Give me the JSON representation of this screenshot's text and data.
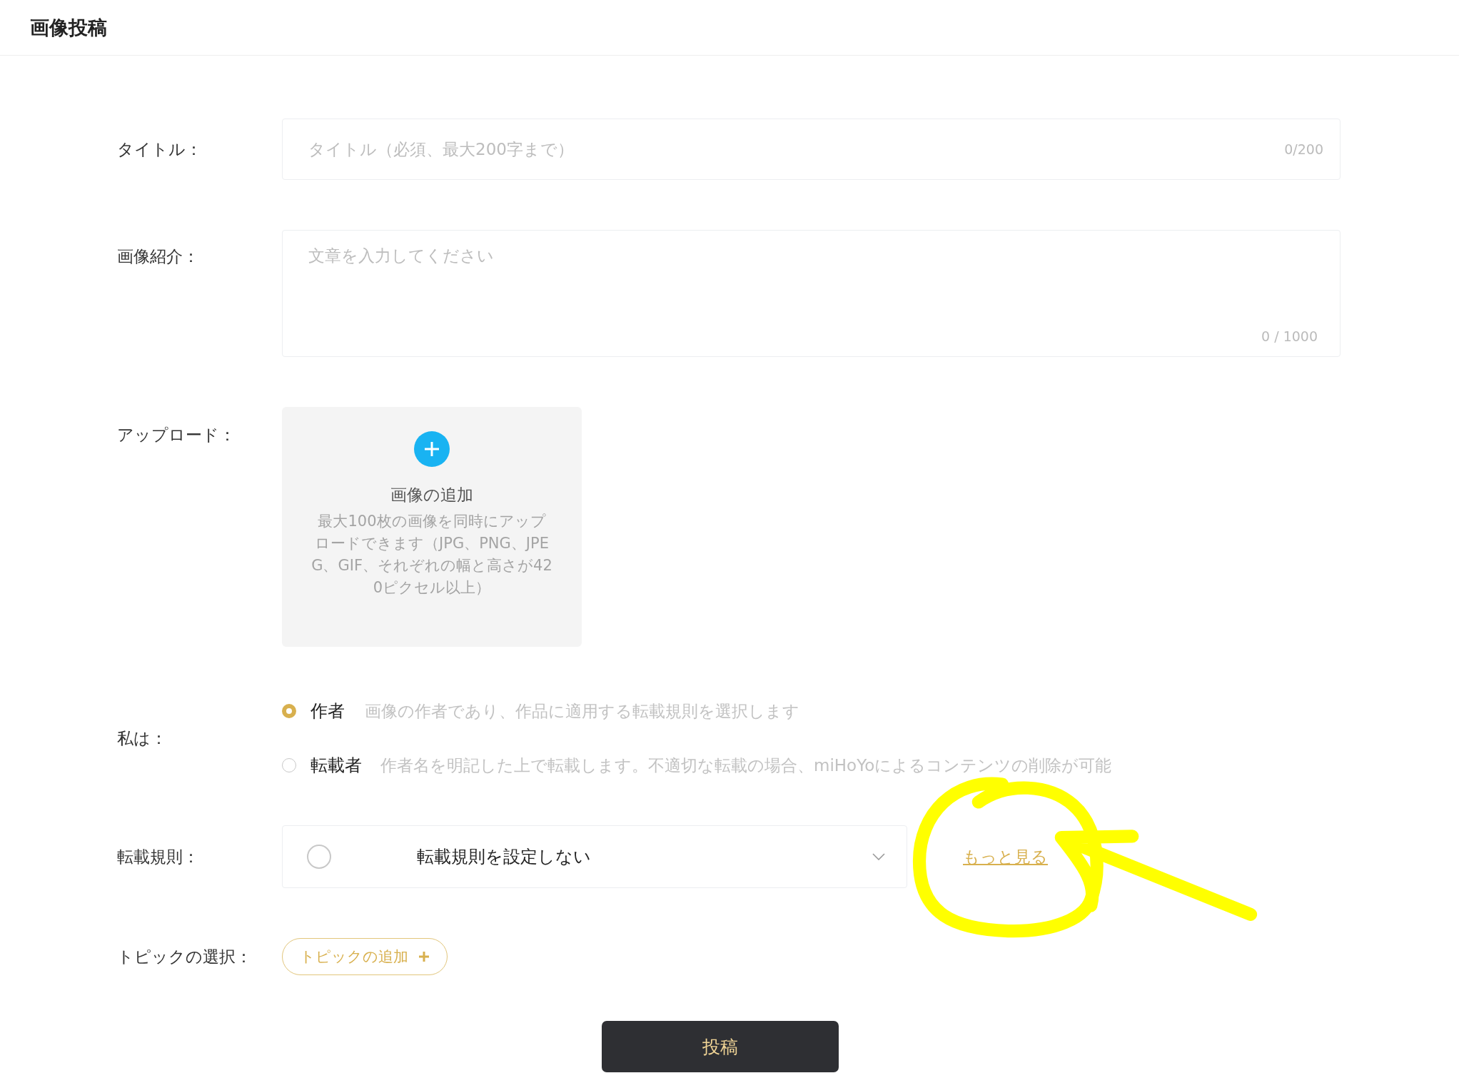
{
  "header": {
    "title": "画像投稿"
  },
  "title_field": {
    "label": "タイトル：",
    "placeholder": "タイトル（必須、最大200字まで）",
    "counter": "0/200"
  },
  "description_field": {
    "label": "画像紹介：",
    "placeholder": "文章を入力してください",
    "counter": "0 / 1000"
  },
  "upload": {
    "label": "アップロード：",
    "button_label": "画像の追加",
    "hint": "最大100枚の画像を同時にアップロードできます（JPG、PNG、JPEG、GIF、それぞれの幅と高さが420ピクセル以上）"
  },
  "role": {
    "label": "私は：",
    "options": [
      {
        "label": "作者",
        "description": "画像の作者であり、作品に適用する転載規則を選択します",
        "selected": true
      },
      {
        "label": "転載者",
        "description": "作者名を明記した上で転載します。不適切な転載の場合、miHoYoによるコンテンツの削除が可能",
        "selected": false
      }
    ]
  },
  "repost_rule": {
    "label": "転載規則：",
    "value": "転載規則を設定しない",
    "checked": false,
    "link": "もっと見る"
  },
  "topic": {
    "label": "トピックの選択：",
    "button": "トピックの追加"
  },
  "submit": {
    "label": "投稿"
  }
}
